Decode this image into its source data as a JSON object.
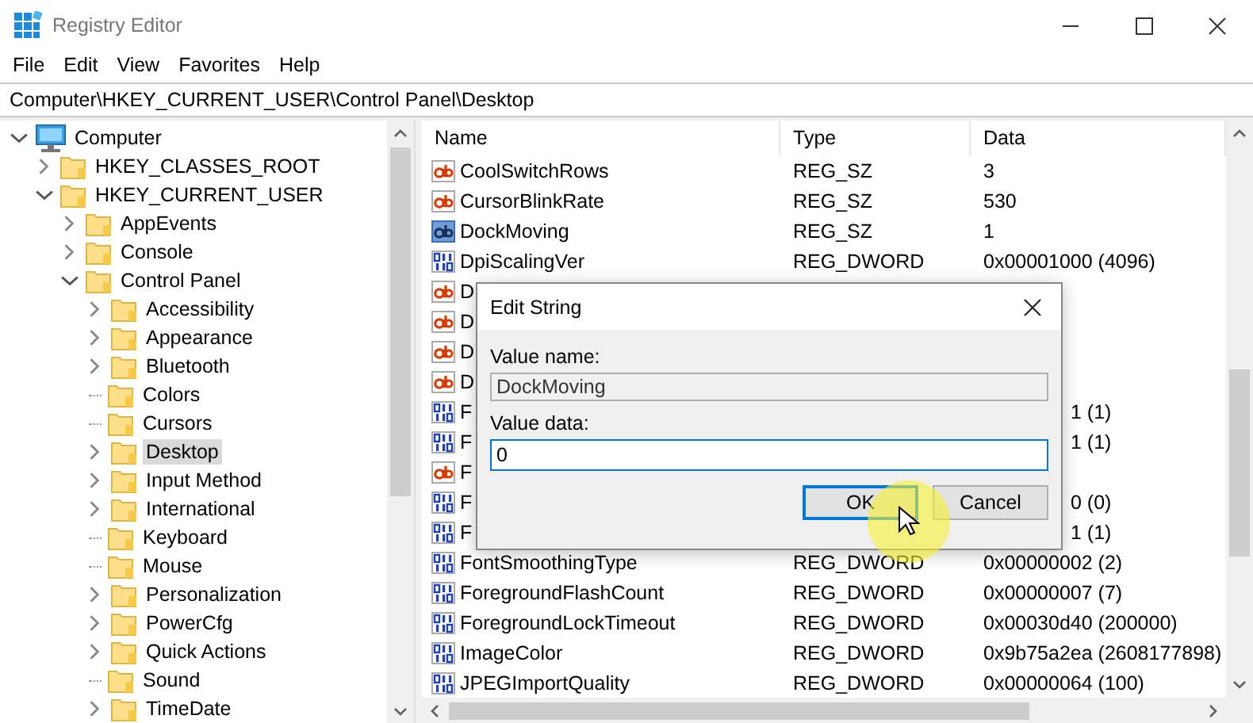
{
  "window": {
    "title": "Registry Editor"
  },
  "menu": [
    "File",
    "Edit",
    "View",
    "Favorites",
    "Help"
  ],
  "address": "Computer\\HKEY_CURRENT_USER\\Control Panel\\Desktop",
  "tree": [
    {
      "label": "Computer",
      "kind": "computer",
      "expanded": true,
      "selected": false,
      "children": [
        {
          "label": "HKEY_CLASSES_ROOT",
          "kind": "key",
          "expanded": false,
          "selected": false
        },
        {
          "label": "HKEY_CURRENT_USER",
          "kind": "key",
          "expanded": true,
          "selected": false,
          "children": [
            {
              "label": "AppEvents",
              "kind": "key",
              "expanded": false,
              "selected": false
            },
            {
              "label": "Console",
              "kind": "key",
              "expanded": false,
              "selected": false
            },
            {
              "label": "Control Panel",
              "kind": "key",
              "expanded": true,
              "selected": false,
              "children": [
                {
                  "label": "Accessibility",
                  "kind": "key",
                  "expanded": false,
                  "selected": false
                },
                {
                  "label": "Appearance",
                  "kind": "key",
                  "expanded": false,
                  "selected": false
                },
                {
                  "label": "Bluetooth",
                  "kind": "key",
                  "expanded": false,
                  "selected": false
                },
                {
                  "label": "Colors",
                  "kind": "leaf",
                  "selected": false
                },
                {
                  "label": "Cursors",
                  "kind": "leaf",
                  "selected": false
                },
                {
                  "label": "Desktop",
                  "kind": "key",
                  "expanded": false,
                  "selected": true
                },
                {
                  "label": "Input Method",
                  "kind": "key",
                  "expanded": false,
                  "selected": false
                },
                {
                  "label": "International",
                  "kind": "key",
                  "expanded": false,
                  "selected": false
                },
                {
                  "label": "Keyboard",
                  "kind": "leaf",
                  "selected": false
                },
                {
                  "label": "Mouse",
                  "kind": "leaf",
                  "selected": false
                },
                {
                  "label": "Personalization",
                  "kind": "key",
                  "expanded": false,
                  "selected": false
                },
                {
                  "label": "PowerCfg",
                  "kind": "key",
                  "expanded": false,
                  "selected": false
                },
                {
                  "label": "Quick Actions",
                  "kind": "key",
                  "expanded": false,
                  "selected": false
                },
                {
                  "label": "Sound",
                  "kind": "leaf",
                  "selected": false
                },
                {
                  "label": "TimeDate",
                  "kind": "key",
                  "expanded": false,
                  "selected": false
                }
              ]
            }
          ]
        }
      ]
    }
  ],
  "list": {
    "columns": [
      "Name",
      "Type",
      "Data"
    ],
    "rows": [
      {
        "kind": "string",
        "covered": false,
        "selected": false,
        "name": "CoolSwitchRows",
        "type": "REG_SZ",
        "data": "3"
      },
      {
        "kind": "string",
        "covered": false,
        "selected": false,
        "name": "CursorBlinkRate",
        "type": "REG_SZ",
        "data": "530"
      },
      {
        "kind": "string",
        "covered": false,
        "selected": true,
        "name": "DockMoving",
        "type": "REG_SZ",
        "data": "1"
      },
      {
        "kind": "dword",
        "covered": false,
        "selected": false,
        "name": "DpiScalingVer",
        "type": "REG_DWORD",
        "data": "0x00001000 (4096)"
      },
      {
        "kind": "string",
        "covered": true,
        "selected": false,
        "name": "D"
      },
      {
        "kind": "string",
        "covered": true,
        "selected": false,
        "name": "D"
      },
      {
        "kind": "string",
        "covered": true,
        "selected": false,
        "name": "D"
      },
      {
        "kind": "string",
        "covered": true,
        "selected": false,
        "name": "D"
      },
      {
        "kind": "dword",
        "covered": true,
        "selected": false,
        "name": "F",
        "data": "1 (1)"
      },
      {
        "kind": "dword",
        "covered": true,
        "selected": false,
        "name": "F",
        "data": "1 (1)"
      },
      {
        "kind": "string",
        "covered": true,
        "selected": false,
        "name": "F"
      },
      {
        "kind": "dword",
        "covered": true,
        "selected": false,
        "name": "F",
        "data": "0 (0)"
      },
      {
        "kind": "dword",
        "covered": true,
        "selected": false,
        "name": "F",
        "data": "1 (1)"
      },
      {
        "kind": "dword",
        "covered": false,
        "selected": false,
        "name": "FontSmoothingType",
        "type": "REG_DWORD",
        "data": "0x00000002 (2)"
      },
      {
        "kind": "dword",
        "covered": false,
        "selected": false,
        "name": "ForegroundFlashCount",
        "type": "REG_DWORD",
        "data": "0x00000007 (7)"
      },
      {
        "kind": "dword",
        "covered": false,
        "selected": false,
        "name": "ForegroundLockTimeout",
        "type": "REG_DWORD",
        "data": "0x00030d40 (200000)"
      },
      {
        "kind": "dword",
        "covered": false,
        "selected": false,
        "name": "ImageColor",
        "type": "REG_DWORD",
        "data": "0x9b75a2ea (2608177898)"
      },
      {
        "kind": "dword",
        "covered": false,
        "selected": false,
        "name": "JPEGImportQuality",
        "type": "REG_DWORD",
        "data": "0x00000064 (100)"
      }
    ]
  },
  "dialog": {
    "title": "Edit String",
    "name_label": "Value name:",
    "name_value": "DockMoving",
    "data_label": "Value data:",
    "data_value": "0",
    "buttons": [
      {
        "label": "OK",
        "default": true
      },
      {
        "label": "Cancel",
        "default": false
      }
    ]
  }
}
